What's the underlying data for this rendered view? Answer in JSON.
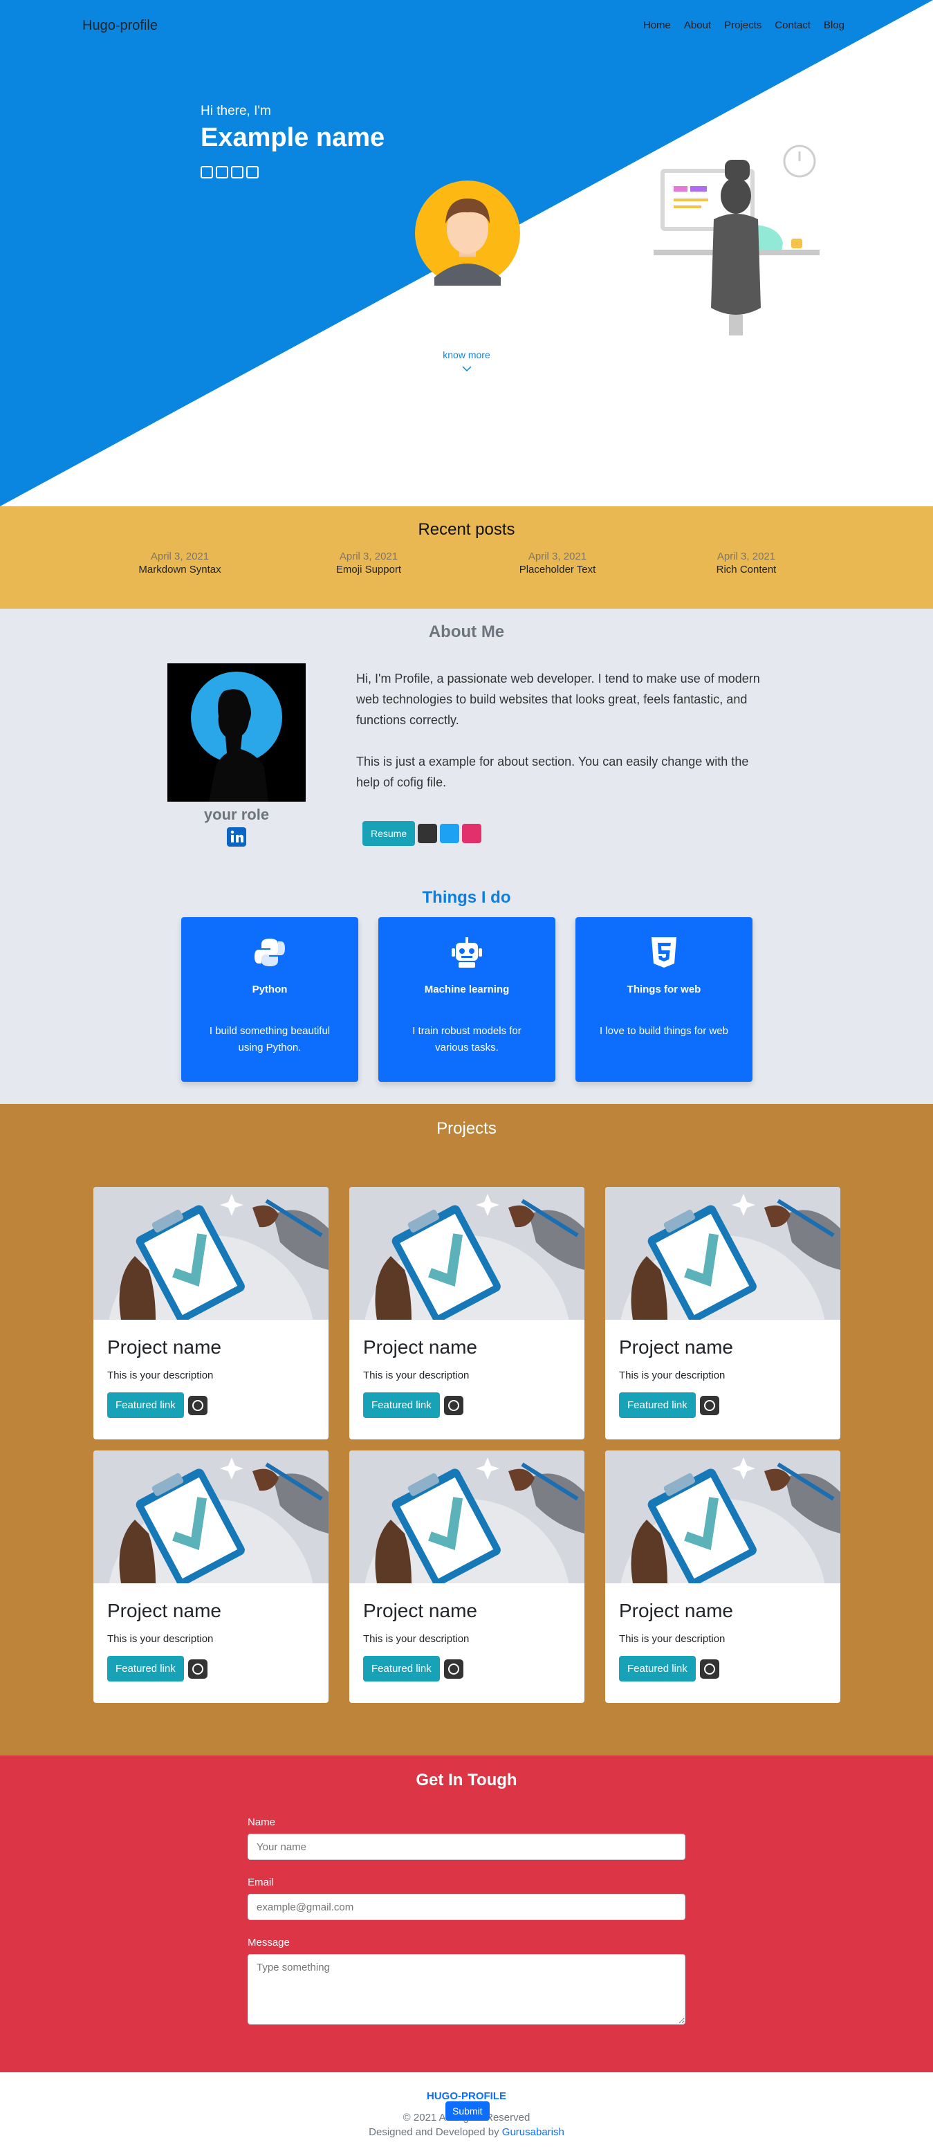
{
  "nav": {
    "brand": "Hugo-profile",
    "links": [
      "Home",
      "About",
      "Projects",
      "Contact",
      "Blog"
    ]
  },
  "hero": {
    "greeting": "Hi there, I'm",
    "name": "Example name",
    "know_more": "know more",
    "social_icons": [
      "github-icon",
      "linkedin-icon",
      "twitter-icon",
      "instagram-icon"
    ]
  },
  "recent_posts": {
    "title": "Recent posts",
    "items": [
      {
        "date": "April 3, 2021",
        "title": "Markdown Syntax"
      },
      {
        "date": "April 3, 2021",
        "title": "Emoji Support"
      },
      {
        "date": "April 3, 2021",
        "title": "Placeholder Text"
      },
      {
        "date": "April 3, 2021",
        "title": "Rich Content"
      }
    ]
  },
  "about": {
    "title": "About Me",
    "role": "your role",
    "paragraph1": "Hi, I'm Profile, a passionate web developer. I tend to make use of modern web technologies to build websites that looks great, feels fantastic, and functions correctly.",
    "paragraph2": "This is just a example for about section. You can easily change with the help of cofig file.",
    "resume_label": "Resume",
    "things_title": "Things I do",
    "things": [
      {
        "icon": "python-icon",
        "title": "Python",
        "desc": "I build something beautiful using Python."
      },
      {
        "icon": "robot-icon",
        "title": "Machine learning",
        "desc": "I train robust models for various tasks."
      },
      {
        "icon": "html5-icon",
        "title": "Things for web",
        "desc": "I love to build things for web"
      }
    ]
  },
  "projects": {
    "title": "Projects",
    "items": [
      {
        "name": "Project name",
        "desc": "This is your description",
        "link_label": "Featured link"
      },
      {
        "name": "Project name",
        "desc": "This is your description",
        "link_label": "Featured link"
      },
      {
        "name": "Project name",
        "desc": "This is your description",
        "link_label": "Featured link"
      },
      {
        "name": "Project name",
        "desc": "This is your description",
        "link_label": "Featured link"
      },
      {
        "name": "Project name",
        "desc": "This is your description",
        "link_label": "Featured link"
      },
      {
        "name": "Project name",
        "desc": "This is your description",
        "link_label": "Featured link"
      }
    ]
  },
  "contact": {
    "title": "Get In Tough",
    "name_label": "Name",
    "name_placeholder": "Your name",
    "email_label": "Email",
    "email_placeholder": "example@gmail.com",
    "message_label": "Message",
    "message_placeholder": "Type something",
    "submit_label": "Submit"
  },
  "footer": {
    "brand": "HUGO-PROFILE",
    "copyright": "© 2021 All Rights Reserved",
    "developed_prefix": "Designed and Developed by",
    "developer": "Gurusabarish"
  },
  "colors": {
    "hero_blue": "#0a86e0",
    "recent_bg": "#e9b852",
    "about_bg": "#e5e8ef",
    "card_blue": "#0d6efd",
    "projects_bg": "#be853a",
    "contact_bg": "#dc3545",
    "accent_teal": "#17a2b8"
  }
}
